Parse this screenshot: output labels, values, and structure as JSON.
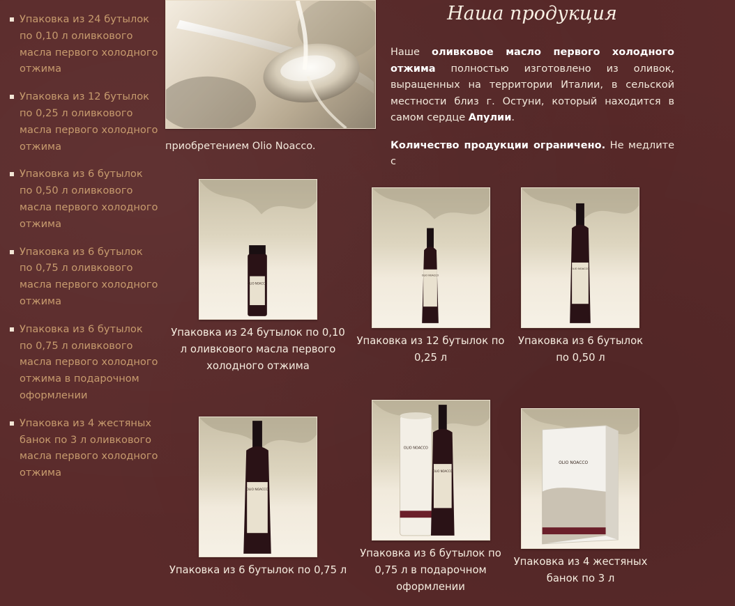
{
  "sidebar": {
    "items": [
      {
        "label": "Упаковка из 24 бутылок по 0,10 л оливкового масла первого холодного отжима"
      },
      {
        "label": "Упаковка из 12 бутылок по 0,25 л оливкового масла первого холодного отжима"
      },
      {
        "label": "Упаковка из 6 бутылок по 0,50 л оливкового масла первого холодного отжима"
      },
      {
        "label": "Упаковка из 6 бутылок по 0,75 л оливкового масла первого холодного отжима"
      },
      {
        "label": "Упаковка из 6 бутылок по 0,75 л оливкового масла первого холодного отжима в подарочном оформлении"
      },
      {
        "label": "Упаковка из 4 жестяных банок по 3 л оливкового масла первого холодного отжима"
      }
    ]
  },
  "main": {
    "title": "Наша продукция",
    "intro": {
      "p1_a": "Наше ",
      "p1_b": "оливковое масло первого холодного отжима",
      "p1_c": " полностью изготовлено из оливок, выращенных на территории Италии, в сельской местности близ г. Остуни, который находится в самом сердце ",
      "p1_d": "Апулии",
      "p1_e": ".",
      "p2_a": "Количество продукции ограничено.",
      "p2_b": " Не медлите с",
      "p2_tail": "приобретением Olio Noacco."
    },
    "products": [
      {
        "caption": "Упаковка из 24 бутылок по 0,10 л оливкового масла первого холодного отжима"
      },
      {
        "caption": "Упаковка из 12 бутылок по 0,25 л"
      },
      {
        "caption": "Упаковка из 6 бутылок по 0,50 л"
      },
      {
        "caption": "Упаковка из 6 бутылок по 0,75 л"
      },
      {
        "caption": "Упаковка из 6 бутылок по 0,75 л в подарочном оформлении"
      },
      {
        "caption": "Упаковка из 4 жестяных банок по 3 л"
      }
    ],
    "label_brand": "OLIO NOACCO"
  },
  "colors": {
    "background": "#5a2a2a",
    "link": "#c79b6e",
    "text": "#f3e9dc"
  }
}
